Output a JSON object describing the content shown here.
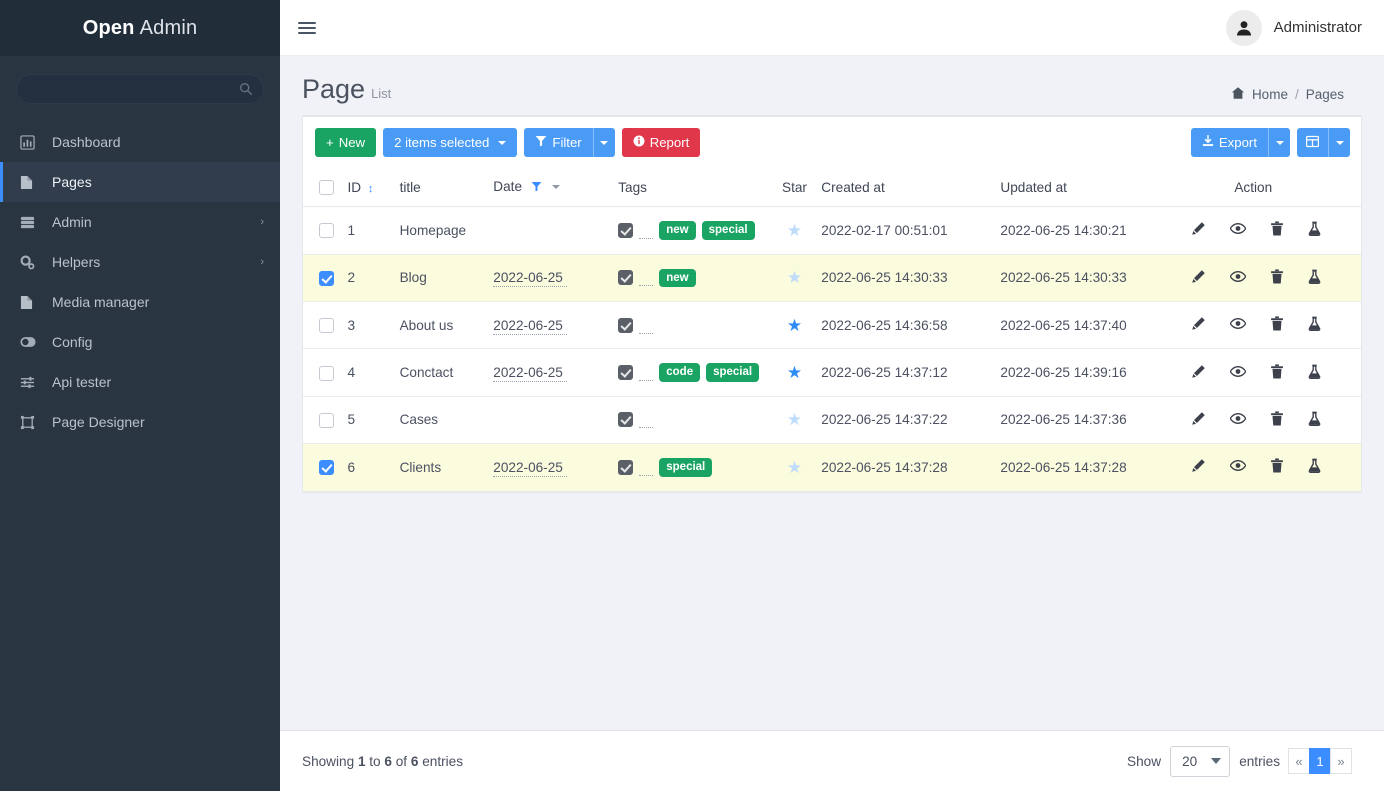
{
  "brand": {
    "strong": "Open",
    "light": "Admin"
  },
  "sidebar": {
    "search_placeholder": "",
    "search_value": "",
    "items": [
      {
        "label": "Dashboard",
        "icon": "chart-bar-icon",
        "active": false,
        "has_caret": false
      },
      {
        "label": "Pages",
        "icon": "file-icon",
        "active": true,
        "has_caret": false
      },
      {
        "label": "Admin",
        "icon": "server-icon",
        "active": false,
        "has_caret": true
      },
      {
        "label": "Helpers",
        "icon": "gears-icon",
        "active": false,
        "has_caret": true
      },
      {
        "label": "Media manager",
        "icon": "file-icon",
        "active": false,
        "has_caret": false
      },
      {
        "label": "Config",
        "icon": "toggle-icon",
        "active": false,
        "has_caret": false
      },
      {
        "label": "Api tester",
        "icon": "sliders-icon",
        "active": false,
        "has_caret": false
      },
      {
        "label": "Page Designer",
        "icon": "designer-icon",
        "active": false,
        "has_caret": false
      }
    ]
  },
  "topbar": {
    "user_name": "Administrator"
  },
  "header": {
    "title": "Page",
    "subtitle": "List",
    "breadcrumb": {
      "home": "Home",
      "sep": "/",
      "current": "Pages"
    }
  },
  "toolbar": {
    "new_label": "New",
    "selected_label": "2 items selected",
    "filter_label": "Filter",
    "report_label": "Report",
    "export_label": "Export"
  },
  "table": {
    "columns": [
      "ID",
      "title",
      "Date",
      "Tags",
      "Star",
      "Created at",
      "Updated at",
      "Action"
    ],
    "rows": [
      {
        "checked": false,
        "id": "1",
        "title": "Homepage",
        "date": "",
        "tags": [],
        "star": false,
        "created": "2022-02-17 00:51:01",
        "updated": "2022-06-25 14:30:21"
      },
      {
        "checked": true,
        "id": "2",
        "title": "Blog",
        "date": "2022-06-25",
        "tags": [
          "new"
        ],
        "star": false,
        "created": "2022-06-25 14:30:33",
        "updated": "2022-06-25 14:30:33"
      },
      {
        "checked": false,
        "id": "3",
        "title": "About us",
        "date": "2022-06-25",
        "tags": [],
        "star": true,
        "created": "2022-06-25 14:36:58",
        "updated": "2022-06-25 14:37:40"
      },
      {
        "checked": false,
        "id": "4",
        "title": "Conctact",
        "date": "2022-06-25",
        "tags": [
          "code",
          "special"
        ],
        "star": true,
        "created": "2022-06-25 14:37:12",
        "updated": "2022-06-25 14:39:16"
      },
      {
        "checked": false,
        "id": "5",
        "title": "Cases",
        "date": "",
        "tags": [],
        "star": false,
        "created": "2022-06-25 14:37:22",
        "updated": "2022-06-25 14:37:36"
      },
      {
        "checked": true,
        "id": "6",
        "title": "Clients",
        "date": "2022-06-25",
        "tags": [
          "special"
        ],
        "star": false,
        "created": "2022-06-25 14:37:28",
        "updated": "2022-06-25 14:37:28"
      }
    ],
    "row1_tags": [
      "new",
      "special"
    ],
    "action_icons": [
      "pencil-icon",
      "eye-icon",
      "trash-icon",
      "flask-icon"
    ]
  },
  "footer": {
    "showing_prefix": "Showing",
    "from": "1",
    "to_word": "to",
    "to": "6",
    "of_word": "of",
    "total": "6",
    "entries_word": "entries",
    "show_label": "Show",
    "page_size": "20",
    "entries_label": "entries",
    "pages": [
      "«",
      "1",
      "»"
    ]
  },
  "colors": {
    "sidebar_bg": "#2a3542",
    "accent_blue": "#3c8dff",
    "green": "#19a463",
    "red": "#e0384a",
    "row_selected": "#fbfbdd"
  }
}
